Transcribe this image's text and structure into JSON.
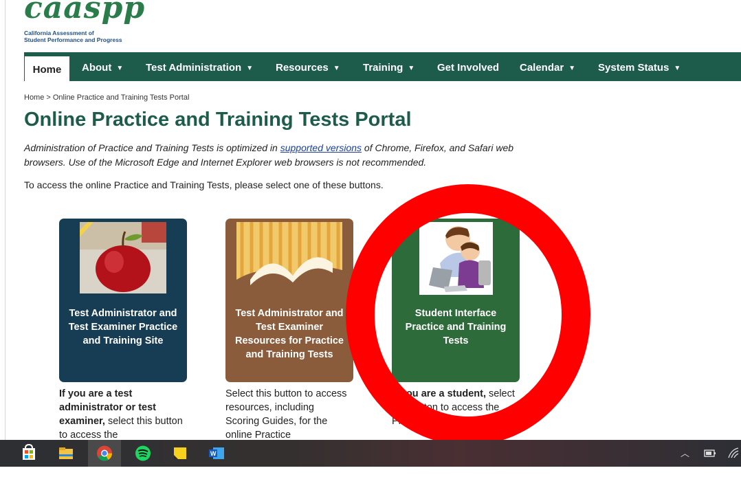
{
  "logo": {
    "wordmark": "caaspp",
    "subtitle_line1": "California Assessment of",
    "subtitle_line2": "Student Performance and Progress"
  },
  "nav": {
    "home": "Home",
    "about": "About",
    "test_administration": "Test Administration",
    "resources": "Resources",
    "training": "Training",
    "get_involved": "Get Involved",
    "calendar": "Calendar",
    "system_status": "System Status"
  },
  "breadcrumb": "Home > Online Practice and Training Tests Portal",
  "title": "Online Practice and Training Tests Portal",
  "intro": {
    "before_link": "Administration of Practice and Training Tests is optimized in ",
    "link": "supported versions",
    "after_link": " of Chrome, Firefox, and Safari web browsers. Use of the Microsoft Edge and Internet Explorer web browsers is not recommended."
  },
  "access_text": "To access the online Practice and Training Tests, please select one of these buttons.",
  "cards": [
    {
      "label": "Test Administrator and Test Examiner Practice and Training Site",
      "desc_bold": "If you are a test administrator or test examiner,",
      "desc_rest": " select this button to access the"
    },
    {
      "label": "Test Administrator and Test Examiner Resources for Practice and Training Tests",
      "desc_bold": "",
      "desc_rest": "Select this button to access resources, including Scoring Guides, for the online Practice"
    },
    {
      "label": "Student Interface Practice and Training Tests",
      "desc_bold": "If you are a student,",
      "desc_rest": " select this button to access the Practice and Training"
    }
  ],
  "colors": {
    "nav_bg": "#1d5c4b",
    "title": "#1d5c4b",
    "card1": "#173d54",
    "card2": "#8b5c3c",
    "card3": "#2e6b3a",
    "annotation_ring": "#ff0000"
  },
  "taskbar": {
    "icons": [
      "store-icon",
      "file-explorer-icon",
      "chrome-icon",
      "spotify-icon",
      "sticky-notes-icon",
      "word-icon"
    ],
    "tray_icons": [
      "chevron-up-icon",
      "battery-icon",
      "wifi-icon"
    ]
  }
}
